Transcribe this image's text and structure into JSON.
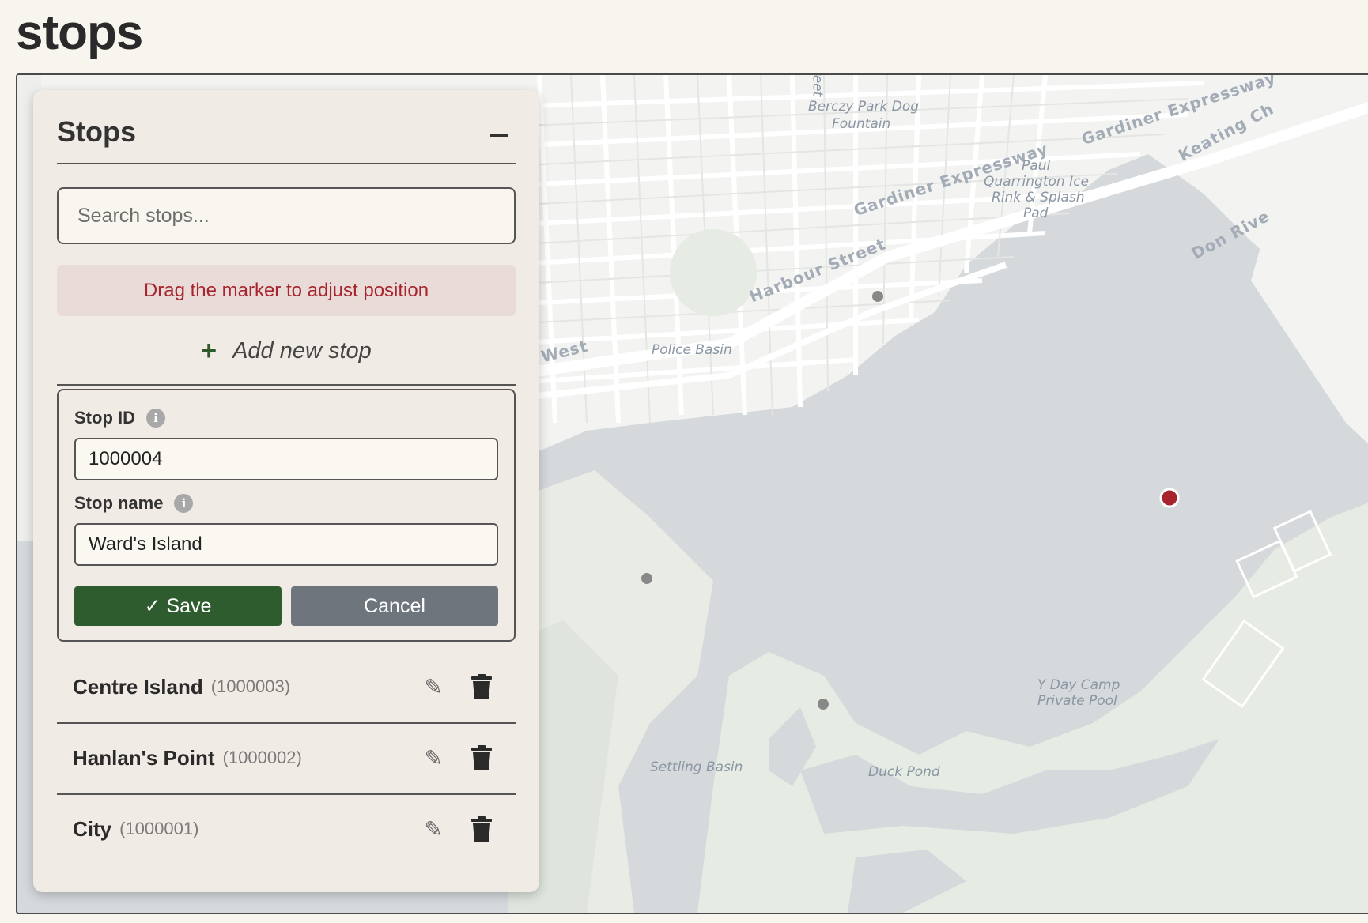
{
  "page": {
    "title": "stops"
  },
  "panel": {
    "title": "Stops",
    "search_placeholder": "Search stops...",
    "hint": "Drag the marker to adjust position",
    "add_label": "Add new stop"
  },
  "form": {
    "stop_id_label": "Stop ID",
    "stop_id_value": "1000004",
    "stop_name_label": "Stop name",
    "stop_name_value": "Ward's Island",
    "save_label": "✓ Save",
    "cancel_label": "Cancel"
  },
  "stops": [
    {
      "name": "Centre Island",
      "id": "(1000003)"
    },
    {
      "name": "Hanlan's Point",
      "id": "(1000002)"
    },
    {
      "name": "City",
      "id": "(1000001)"
    }
  ],
  "map": {
    "labels": {
      "berczy": "Berczy Park Dog",
      "berczy2": "Fountain",
      "gardiner1": "Gardiner Expressway",
      "gardiner2": "Gardiner Expressway",
      "keating": "Keating Ch",
      "paul1": "Paul",
      "paul2": "Quarrington Ice",
      "paul3": "Rink & Splash",
      "paul4": "Pad",
      "donriver": "Don Rive",
      "harbour": "Harbour Street",
      "queens": "vard West",
      "police": "Police Basin",
      "ydaycamp1": "Y Day Camp",
      "ydaycamp2": "Private Pool",
      "settling": "Settling Basin",
      "duck": "Duck Pond",
      "street": "reet"
    },
    "colors": {
      "water": "#d5d9dc",
      "land": "#f3f4f1",
      "park": "#e6ebe3",
      "road": "#ffffff",
      "active_marker": "#a8242c",
      "marker": "#888888"
    }
  }
}
